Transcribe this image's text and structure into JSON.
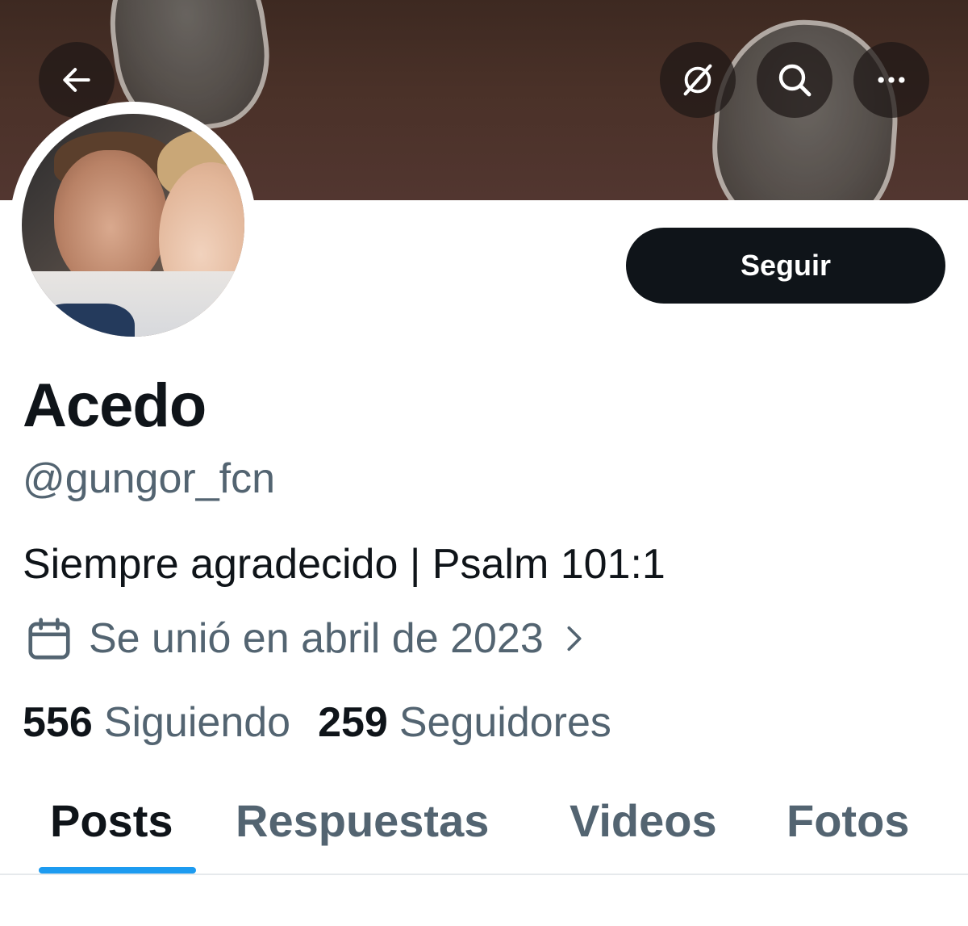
{
  "header": {
    "back_icon": "arrow-left-icon",
    "grok_icon": "grok-icon",
    "search_icon": "search-icon",
    "more_icon": "more-horizontal-icon"
  },
  "profile": {
    "display_name": "Acedo",
    "handle": "@gungor_fcn",
    "bio": "Siempre agradecido | Psalm 101:1",
    "joined": "Se unió en abril de 2023",
    "joined_icon": "calendar-icon",
    "follow_label": "Seguir"
  },
  "stats": {
    "following_count": "556",
    "following_label": "Siguiendo",
    "followers_count": "259",
    "followers_label": "Seguidores"
  },
  "tabs": [
    {
      "label": "Posts",
      "active": true
    },
    {
      "label": "Respuestas",
      "active": false
    },
    {
      "label": "Videos",
      "active": false
    },
    {
      "label": "Fotos",
      "active": false
    }
  ],
  "colors": {
    "accent": "#1d9bf0",
    "text_primary": "#0f1419",
    "text_secondary": "#536471",
    "button_bg": "#0f1419"
  }
}
